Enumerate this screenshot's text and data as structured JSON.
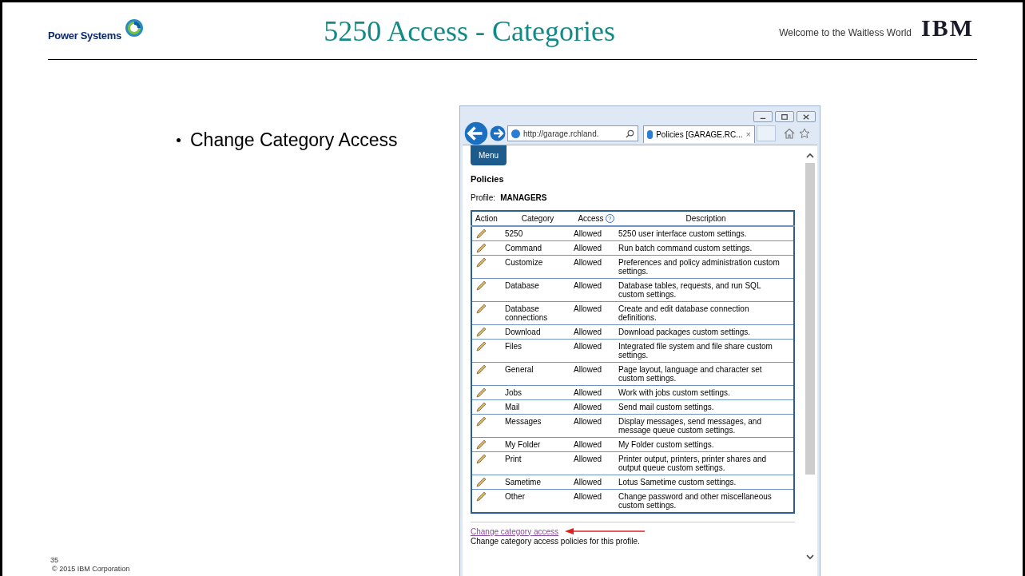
{
  "header": {
    "brand": "Power Systems",
    "title": "5250 Access - Categories",
    "tagline": "Welcome to the Waitless World",
    "logo": "IBM"
  },
  "bullets": [
    "Change Category Access"
  ],
  "browser": {
    "address": "http://garage.rchland.",
    "tab": {
      "label": "Policies [GARAGE.RC...",
      "close": "×"
    },
    "page": {
      "menu_button": "Menu",
      "heading": "Policies",
      "profile_label": "Profile:",
      "profile_value": "MANAGERS",
      "table": {
        "columns": [
          "Action",
          "Category",
          "Access",
          "Description"
        ],
        "help": "?",
        "rows": [
          {
            "category": "5250",
            "access": "Allowed",
            "description": "5250 user interface custom settings."
          },
          {
            "category": "Command",
            "access": "Allowed",
            "description": "Run batch command custom settings."
          },
          {
            "category": "Customize",
            "access": "Allowed",
            "description": "Preferences and policy administration custom settings."
          },
          {
            "category": "Database",
            "access": "Allowed",
            "description": "Database tables, requests, and run SQL custom settings."
          },
          {
            "category": "Database connections",
            "access": "Allowed",
            "description": "Create and edit database connection definitions."
          },
          {
            "category": "Download",
            "access": "Allowed",
            "description": "Download packages custom settings."
          },
          {
            "category": "Files",
            "access": "Allowed",
            "description": "Integrated file system and file share custom settings."
          },
          {
            "category": "General",
            "access": "Allowed",
            "description": "Page layout, language and character set custom settings."
          },
          {
            "category": "Jobs",
            "access": "Allowed",
            "description": "Work with jobs custom settings."
          },
          {
            "category": "Mail",
            "access": "Allowed",
            "description": "Send mail custom settings."
          },
          {
            "category": "Messages",
            "access": "Allowed",
            "description": "Display messages, send messages, and message queue custom settings."
          },
          {
            "category": "My Folder",
            "access": "Allowed",
            "description": "My Folder custom settings."
          },
          {
            "category": "Print",
            "access": "Allowed",
            "description": "Printer output, printers, printer shares and output queue custom settings."
          },
          {
            "category": "Sametime",
            "access": "Allowed",
            "description": "Lotus Sametime custom settings."
          },
          {
            "category": "Other",
            "access": "Allowed",
            "description": "Change password and other miscellaneous custom settings."
          }
        ]
      },
      "link": "Change category access",
      "link_description": "Change category access policies for this profile."
    }
  },
  "footer": {
    "page_number": "35",
    "copyright": "© 2015 IBM Corporation"
  }
}
